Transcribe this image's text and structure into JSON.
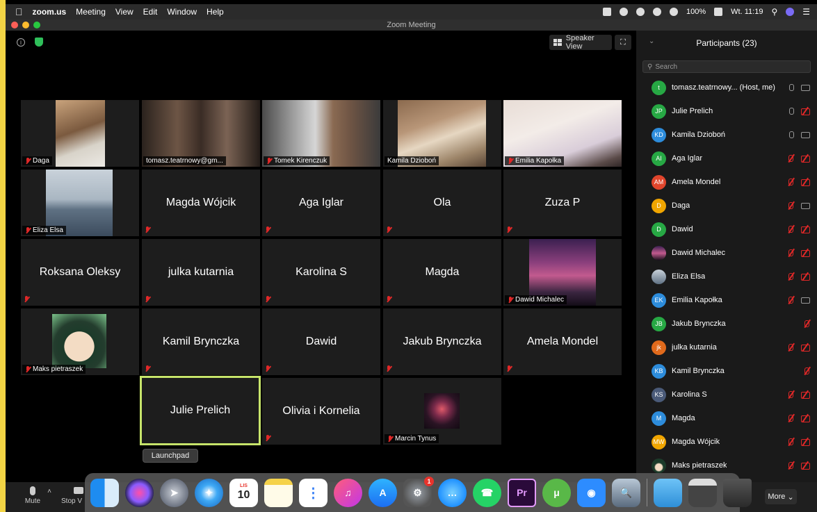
{
  "menubar": {
    "app_name": "zoom.us",
    "items": [
      "Meeting",
      "View",
      "Edit",
      "Window",
      "Help"
    ],
    "battery": "100%",
    "clock": "Wt. 11:19"
  },
  "window": {
    "title": "Zoom Meeting"
  },
  "stage": {
    "speaker_view_label": "Speaker View",
    "tiles": [
      {
        "name": "Daga",
        "kind": "video",
        "muted": true
      },
      {
        "name": "tomasz.teatrnowy@gm...",
        "kind": "video",
        "muted": false
      },
      {
        "name": "Tomek Kirenczuk",
        "kind": "video",
        "muted": true
      },
      {
        "name": "Kamila Dzioboń",
        "kind": "video",
        "muted": false
      },
      {
        "name": "Emilia Kapołka",
        "kind": "video",
        "muted": true
      },
      {
        "name": "Eliza Elsa",
        "kind": "photo",
        "muted": true
      },
      {
        "name": "Magda Wójcik",
        "kind": "name",
        "muted": true
      },
      {
        "name": "Aga Iglar",
        "kind": "name",
        "muted": true
      },
      {
        "name": "Ola",
        "kind": "name",
        "muted": true
      },
      {
        "name": "Zuza P",
        "kind": "name",
        "muted": true
      },
      {
        "name": "Roksana Oleksy",
        "kind": "name",
        "muted": true
      },
      {
        "name": "julka kutarnia",
        "kind": "name",
        "muted": true
      },
      {
        "name": "Karolina S",
        "kind": "name",
        "muted": true
      },
      {
        "name": "Magda",
        "kind": "name",
        "muted": true
      },
      {
        "name": "Dawid Michalec",
        "kind": "photo",
        "muted": true
      },
      {
        "name": "Maks pietraszek",
        "kind": "photo",
        "muted": true
      },
      {
        "name": "Kamil Brynczka",
        "kind": "name",
        "muted": true
      },
      {
        "name": "Dawid",
        "kind": "name",
        "muted": true
      },
      {
        "name": "Jakub Brynczka",
        "kind": "name",
        "muted": true
      },
      {
        "name": "Amela Mondel",
        "kind": "name",
        "muted": true
      },
      {
        "name": "Julie Prelich",
        "kind": "name",
        "muted": false,
        "active": true
      },
      {
        "name": "Olivia i Kornelia",
        "kind": "name",
        "muted": true
      },
      {
        "name": "Marcin Tynus",
        "kind": "photo",
        "muted": true
      }
    ]
  },
  "participants": {
    "title": "Participants (23)",
    "search_placeholder": "Search",
    "list": [
      {
        "initials": "t",
        "name": "tomasz.teatrnowy... (Host, me)",
        "color": "#27a844",
        "mic": "on",
        "cam": "on"
      },
      {
        "initials": "JP",
        "name": "Julie Prelich",
        "color": "#27a844",
        "mic": "on",
        "cam": "off"
      },
      {
        "initials": "KD",
        "name": "Kamila Dzioboń",
        "color": "#2d8cdb",
        "mic": "on",
        "cam": "on"
      },
      {
        "initials": "AI",
        "name": "Aga Iglar",
        "color": "#27a844",
        "mic": "off",
        "cam": "off"
      },
      {
        "initials": "AM",
        "name": "Amela Mondel",
        "color": "#e0452c",
        "mic": "off",
        "cam": "off"
      },
      {
        "initials": "D",
        "name": "Daga",
        "color": "#f0a500",
        "mic": "off",
        "cam": "on"
      },
      {
        "initials": "D",
        "name": "Dawid",
        "color": "#27a844",
        "mic": "off",
        "cam": "off"
      },
      {
        "initials": "",
        "name": "Dawid Michalec",
        "color": "#6a3b6a",
        "mic": "off",
        "cam": "off"
      },
      {
        "initials": "",
        "name": "Eliza Elsa",
        "color": "#8a8f96",
        "mic": "off",
        "cam": "off"
      },
      {
        "initials": "EK",
        "name": "Emilia Kapołka",
        "color": "#2d8cdb",
        "mic": "off",
        "cam": "on"
      },
      {
        "initials": "JB",
        "name": "Jakub Brynczka",
        "color": "#27a844",
        "mic": "off",
        "cam": "none"
      },
      {
        "initials": "jk",
        "name": "julka kutarnia",
        "color": "#e06a1c",
        "mic": "off",
        "cam": "off"
      },
      {
        "initials": "KB",
        "name": "Kamil Brynczka",
        "color": "#2d8cdb",
        "mic": "off",
        "cam": "none"
      },
      {
        "initials": "KS",
        "name": "Karolina S",
        "color": "#4a5a78",
        "mic": "off",
        "cam": "off"
      },
      {
        "initials": "M",
        "name": "Magda",
        "color": "#2d8cdb",
        "mic": "off",
        "cam": "off"
      },
      {
        "initials": "MW",
        "name": "Magda Wójcik",
        "color": "#f0a500",
        "mic": "off",
        "cam": "off"
      },
      {
        "initials": "",
        "name": "Maks pietraszek",
        "color": "#2a6b3a",
        "mic": "off",
        "cam": "off"
      }
    ]
  },
  "toolbar": {
    "mute_label": "Mute",
    "stop_video_label": "Stop V",
    "more_label": "More"
  },
  "dock": {
    "tooltip": "Launchpad",
    "calendar_month": "LIS",
    "calendar_day": "10",
    "settings_badge": "1",
    "premiere_label": "Pr"
  }
}
